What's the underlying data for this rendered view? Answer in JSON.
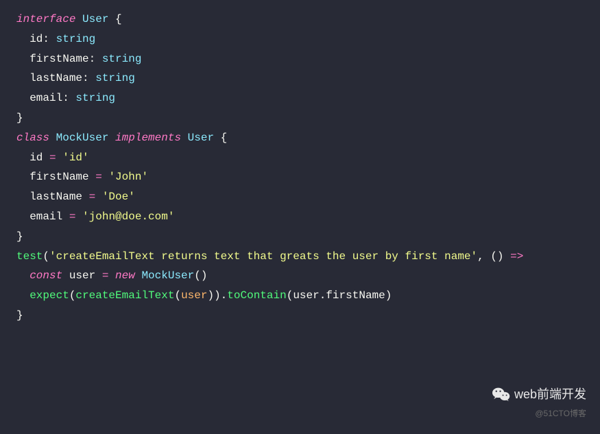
{
  "code": {
    "line1": {
      "kw": "interface",
      "name": "User",
      "brace": " {"
    },
    "line2": {
      "indent": "  ",
      "prop": "id",
      "colon": ": ",
      "type": "string"
    },
    "line3": {
      "indent": "  ",
      "prop": "firstName",
      "colon": ": ",
      "type": "string"
    },
    "line4": {
      "indent": "  ",
      "prop": "lastName",
      "colon": ": ",
      "type": "string"
    },
    "line5": {
      "indent": "  ",
      "prop": "email",
      "colon": ": ",
      "type": "string"
    },
    "line6": {
      "brace": "}"
    },
    "line7": {
      "blank": ""
    },
    "line8": {
      "kw1": "class",
      "name1": "MockUser",
      "kw2": "implements",
      "name2": "User",
      "brace": " {"
    },
    "line9": {
      "indent": "  ",
      "prop": "id",
      "eq": " = ",
      "str": "'id'"
    },
    "line10": {
      "indent": "  ",
      "prop": "firstName",
      "eq": " = ",
      "str": "'John'"
    },
    "line11": {
      "indent": "  ",
      "prop": "lastName",
      "eq": " = ",
      "str": "'Doe'"
    },
    "line12": {
      "indent": "  ",
      "prop": "email",
      "eq": " = ",
      "str": "'john@doe.com'"
    },
    "line13": {
      "brace": "}"
    },
    "line14": {
      "blank": ""
    },
    "line15": {
      "fn": "test",
      "p1": "(",
      "str": "'createEmailText returns text that greats the user by first name'",
      "comma": ", () ",
      "arrow": "=>",
      "rest": " "
    },
    "line16": {
      "indent": "  ",
      "kw": "const",
      "var": " user ",
      "eq": "= ",
      "new": "new",
      "cls": " MockUser",
      "p": "()"
    },
    "line17": {
      "blank": ""
    },
    "line18": {
      "indent": "  ",
      "fn1": "expect",
      "p1": "(",
      "fn2": "createEmailText",
      "p2": "(",
      "arg": "user",
      "p3": ")).",
      "method": "toContain",
      "p4": "(",
      "obj": "user",
      "dot": ".",
      "prop": "firstName",
      "p5": ")"
    },
    "line19": {
      "brace": "}"
    }
  },
  "watermark": {
    "top": "web前端开发",
    "bottom": "@51CTO博客"
  }
}
